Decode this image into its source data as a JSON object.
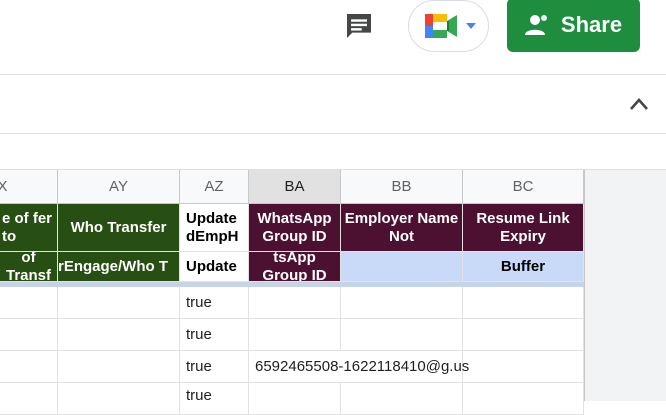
{
  "toolbar": {
    "share_label": "Share",
    "icons": [
      "comment-icon",
      "google-meet-icon",
      "dropdown-arrow-icon",
      "person-icon",
      "chevron-up-icon"
    ]
  },
  "columns": [
    {
      "id": "X",
      "label": "X"
    },
    {
      "id": "AY",
      "label": "AY"
    },
    {
      "id": "AZ",
      "label": "AZ"
    },
    {
      "id": "BA",
      "label": "BA"
    },
    {
      "id": "BB",
      "label": "BB"
    },
    {
      "id": "BC",
      "label": "BC"
    }
  ],
  "header_row_1": {
    "X": "e of fer to",
    "AY": "Who Transfer",
    "AZ": "Update dEmpH",
    "BA": "WhatsApp Group ID",
    "BB": "Employer Name Not",
    "BC": "Resume Link Expiry"
  },
  "header_row_2": {
    "X": "of Transf",
    "AY": "rEngage/Who T",
    "AZ": "Update",
    "BA": "tsApp Group ID",
    "BB": "",
    "BC": "Buffer"
  },
  "rows": [
    {
      "AZ": "true",
      "BA": ""
    },
    {
      "AZ": "true",
      "BA": ""
    },
    {
      "AZ": "true",
      "BA": "6592465508-1622118410@g.us"
    },
    {
      "AZ": "true",
      "BA": ""
    }
  ],
  "colors": {
    "share_green": "#1e8e3e",
    "header_green": "#274e13",
    "header_maroon": "#4c1130",
    "header_lightblue": "#c9daf8"
  }
}
